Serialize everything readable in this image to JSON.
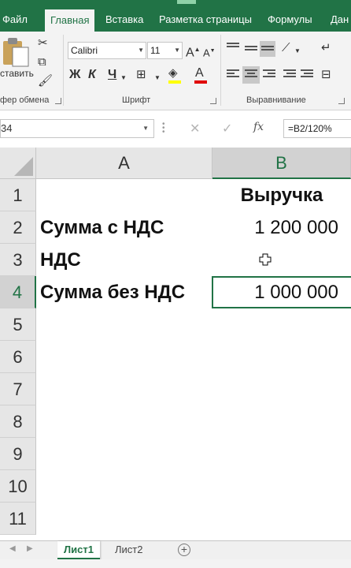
{
  "ribbon_tabs": [
    {
      "label": "Файл",
      "active": false
    },
    {
      "label": "Главная",
      "active": true
    },
    {
      "label": "Вставка",
      "active": false
    },
    {
      "label": "Разметка страницы",
      "active": false
    },
    {
      "label": "Формулы",
      "active": false
    },
    {
      "label": "Дан",
      "active": false
    }
  ],
  "ribbon": {
    "paste_label": "ставить",
    "clipboard_label": "фер обмена",
    "font_label": "Шрифт",
    "alignment_label": "Выравнивание",
    "font_name": "Calibri",
    "font_size": "11",
    "bold": "Ж",
    "italic": "К",
    "underline": "Ч",
    "grow_font": "A",
    "shrink_font": "A",
    "font_color_letter": "A"
  },
  "formula_bar": {
    "name_box": "34",
    "formula": "=B2/120%",
    "fx": "fx"
  },
  "columns": [
    {
      "label": "A",
      "selected": false
    },
    {
      "label": "B",
      "selected": true
    }
  ],
  "rows": [
    {
      "num": "1",
      "a": "",
      "b": "Выручка"
    },
    {
      "num": "2",
      "a": "Сумма с НДС",
      "b": "1 200 000"
    },
    {
      "num": "3",
      "a": "НДС",
      "b": ""
    },
    {
      "num": "4",
      "a": "Сумма без НДС",
      "b": "1 000 000"
    },
    {
      "num": "5",
      "a": "",
      "b": ""
    },
    {
      "num": "6",
      "a": "",
      "b": ""
    },
    {
      "num": "7",
      "a": "",
      "b": ""
    },
    {
      "num": "8",
      "a": "",
      "b": ""
    },
    {
      "num": "9",
      "a": "",
      "b": ""
    },
    {
      "num": "10",
      "a": "",
      "b": ""
    },
    {
      "num": "11",
      "a": "",
      "b": ""
    }
  ],
  "sheets": [
    {
      "label": "Лист1",
      "active": true
    },
    {
      "label": "Лист2",
      "active": false
    }
  ],
  "add_sheet": "+",
  "colors": {
    "excel_green": "#217346",
    "header_gray": "#e6e6e6",
    "selected_header": "#d2d2d2"
  }
}
